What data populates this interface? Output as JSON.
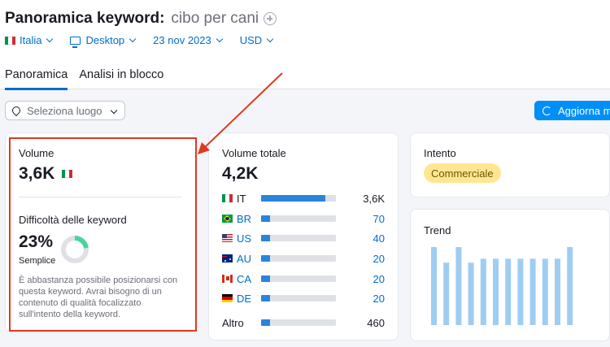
{
  "header": {
    "title": "Panoramica keyword:",
    "keyword": "cibo per cani",
    "filters": {
      "country": "Italia",
      "device": "Desktop",
      "date": "23 nov 2023",
      "currency": "USD"
    },
    "tabs": [
      {
        "label": "Panoramica",
        "active": true
      },
      {
        "label": "Analisi in blocco",
        "active": false
      }
    ]
  },
  "toolbar": {
    "location_placeholder": "Seleziona luogo",
    "update_label": "Aggiorna m"
  },
  "volume_card": {
    "label": "Volume",
    "value": "3,6K",
    "kd_label": "Difficoltà delle keyword",
    "kd_value": "23%",
    "kd_percent": 23,
    "kd_level": "Semplice",
    "kd_description": "È abbastanza possibile posizionarsi con questa keyword. Avrai bisogno di un contenuto di qualità focalizzato sull'intento della keyword."
  },
  "total_volume_card": {
    "label": "Volume totale",
    "value": "4,2K",
    "countries": [
      {
        "code": "IT",
        "value": "3,6K",
        "share": 0.86,
        "flag": "italy-flag"
      },
      {
        "code": "BR",
        "value": "70",
        "share": 0.017,
        "flag": "brazil-flag"
      },
      {
        "code": "US",
        "value": "40",
        "share": 0.01,
        "flag": "usa-flag"
      },
      {
        "code": "AU",
        "value": "20",
        "share": 0.005,
        "flag": "australia-flag"
      },
      {
        "code": "CA",
        "value": "20",
        "share": 0.005,
        "flag": "canada-flag"
      },
      {
        "code": "DE",
        "value": "20",
        "share": 0.005,
        "flag": "germany-flag"
      }
    ],
    "other": {
      "label": "Altro",
      "value": "460",
      "share": 0.11
    }
  },
  "intent_card": {
    "label": "Intento",
    "badge": "Commerciale"
  },
  "trend_card": {
    "label": "Trend",
    "values": [
      1.0,
      0.8,
      1.0,
      0.8,
      0.85,
      0.85,
      0.85,
      0.85,
      0.85,
      0.85,
      0.85,
      1.0
    ]
  },
  "colors": {
    "accent": "#006dca",
    "button": "#008ff8",
    "bar": "#2b84dc",
    "trend_bar": "#9fcdf2",
    "highlight": "#e0391f",
    "badge": "#ffe792",
    "kd_ring": "#49d49d"
  }
}
